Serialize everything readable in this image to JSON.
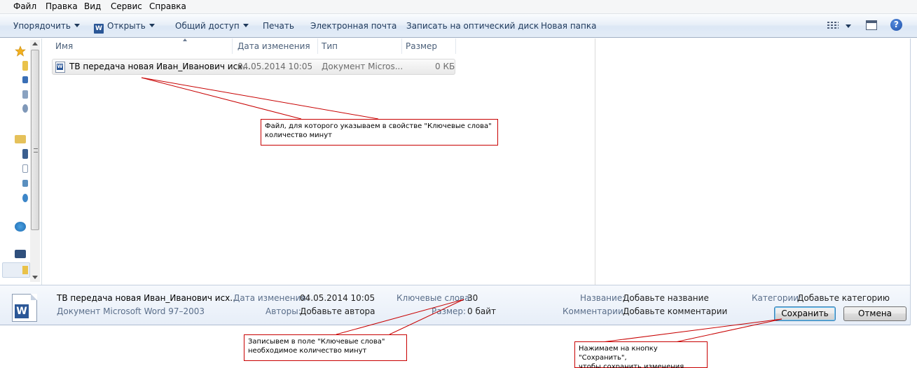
{
  "menu": {
    "items": [
      {
        "label": "Файл"
      },
      {
        "label": "Правка"
      },
      {
        "label": "Вид"
      },
      {
        "label": "Сервис"
      },
      {
        "label": "Справка"
      }
    ]
  },
  "toolbar": {
    "organize": "Упорядочить",
    "open": "Открыть",
    "share": "Общий доступ",
    "print": "Печать",
    "email": "Электронная почта",
    "burn": "Записать на оптический диск",
    "new_folder": "Новая папка",
    "help": "?"
  },
  "columns": {
    "name": "Имя",
    "date": "Дата изменения",
    "type": "Тип",
    "size": "Размер"
  },
  "file": {
    "name": "ТВ передача новая Иван_Иванович исх...",
    "date": "04.05.2014 10:05",
    "type": "Документ Micros...",
    "size": "0 КБ"
  },
  "details": {
    "title": "ТВ передача новая Иван_Иванович исх...",
    "subtitle": "Документ Microsoft Word 97–2003",
    "date_label": "Дата изменения:",
    "date_value": "04.05.2014 10:05",
    "keywords_label": "Ключевые слова:",
    "keywords_value": "30",
    "authors_label": "Авторы:",
    "authors_value": "Добавьте автора",
    "size_label": "Размер:",
    "size_value": "0 байт",
    "name_label": "Название:",
    "name_value": "Добавьте название",
    "comments_label": "Комментарии:",
    "comments_value": "Добавьте комментарии",
    "categories_label": "Категории:",
    "categories_value": "Добавьте категорию"
  },
  "buttons": {
    "save": "Сохранить",
    "cancel": "Отмена"
  },
  "annotations": {
    "file_note_1": "Файл, для которого указываем в свойстве \"Ключевые слова\"",
    "file_note_2": "количество минут",
    "keywords_note_1": "Записывем в поле \"Ключевые слова\"",
    "keywords_note_2": "необходимое количество минут",
    "save_note_1": "Нажимаем на кнопку \"Сохранить\",",
    "save_note_2": "чтобы сохранить изменения"
  },
  "colors": {
    "annotation_border": "#c80000",
    "accent": "#2b5797"
  }
}
